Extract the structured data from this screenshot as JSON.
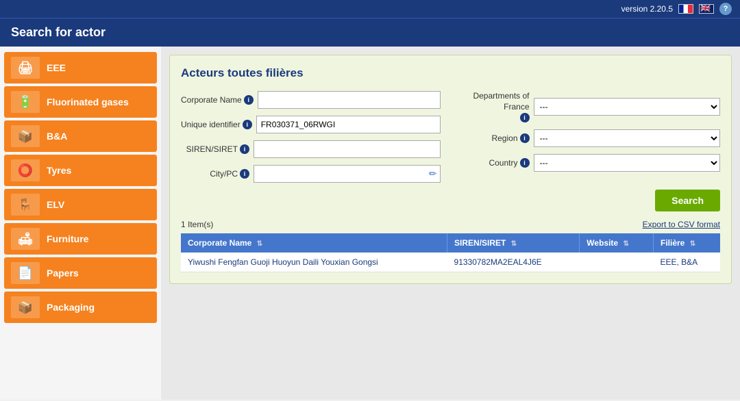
{
  "topbar": {
    "version": "version 2.20.5"
  },
  "header": {
    "title": "Search for actor"
  },
  "sidebar": {
    "items": [
      {
        "id": "eee",
        "label": "EEE",
        "icon": "🖨"
      },
      {
        "id": "fluorinated-gases",
        "label": "Fluorinated gases",
        "icon": "🔋"
      },
      {
        "id": "bna",
        "label": "B&A",
        "icon": "📦"
      },
      {
        "id": "tyres",
        "label": "Tyres",
        "icon": "⭕"
      },
      {
        "id": "elv",
        "label": "ELV",
        "icon": "🪑"
      },
      {
        "id": "furniture",
        "label": "Furniture",
        "icon": "🛋"
      },
      {
        "id": "papers",
        "label": "Papers",
        "icon": "📄"
      },
      {
        "id": "packaging",
        "label": "Packaging",
        "icon": "📦"
      }
    ]
  },
  "panel": {
    "title": "Acteurs toutes filières",
    "form": {
      "corporate_name_label": "Corporate Name",
      "unique_id_label": "Unique identifier",
      "siren_label": "SIREN/SIRET",
      "city_label": "City/PC",
      "departments_label_line1": "Departments of",
      "departments_label_line2": "France",
      "region_label": "Region",
      "country_label": "Country",
      "unique_id_value": "FR030371_06RWGI",
      "corporate_name_value": "",
      "siren_value": "",
      "city_value": "",
      "departments_value": "---",
      "region_value": "---",
      "country_value": "---",
      "departments_options": [
        "---"
      ],
      "region_options": [
        "---"
      ],
      "country_options": [
        "---"
      ]
    },
    "search_button": "Search",
    "export_link": "Export to CSV format",
    "results_count": "1 Item(s)",
    "table": {
      "headers": [
        "Corporate Name",
        "SIREN/SIRET",
        "Website",
        "Filière"
      ],
      "rows": [
        {
          "corporate_name": "Yiwushi Fengfan Guoji Huoyun Daili Youxian Gongsi",
          "siren": "91330782MA2EAL4J6E",
          "website": "",
          "filiere": "EEE, B&A"
        }
      ]
    }
  }
}
